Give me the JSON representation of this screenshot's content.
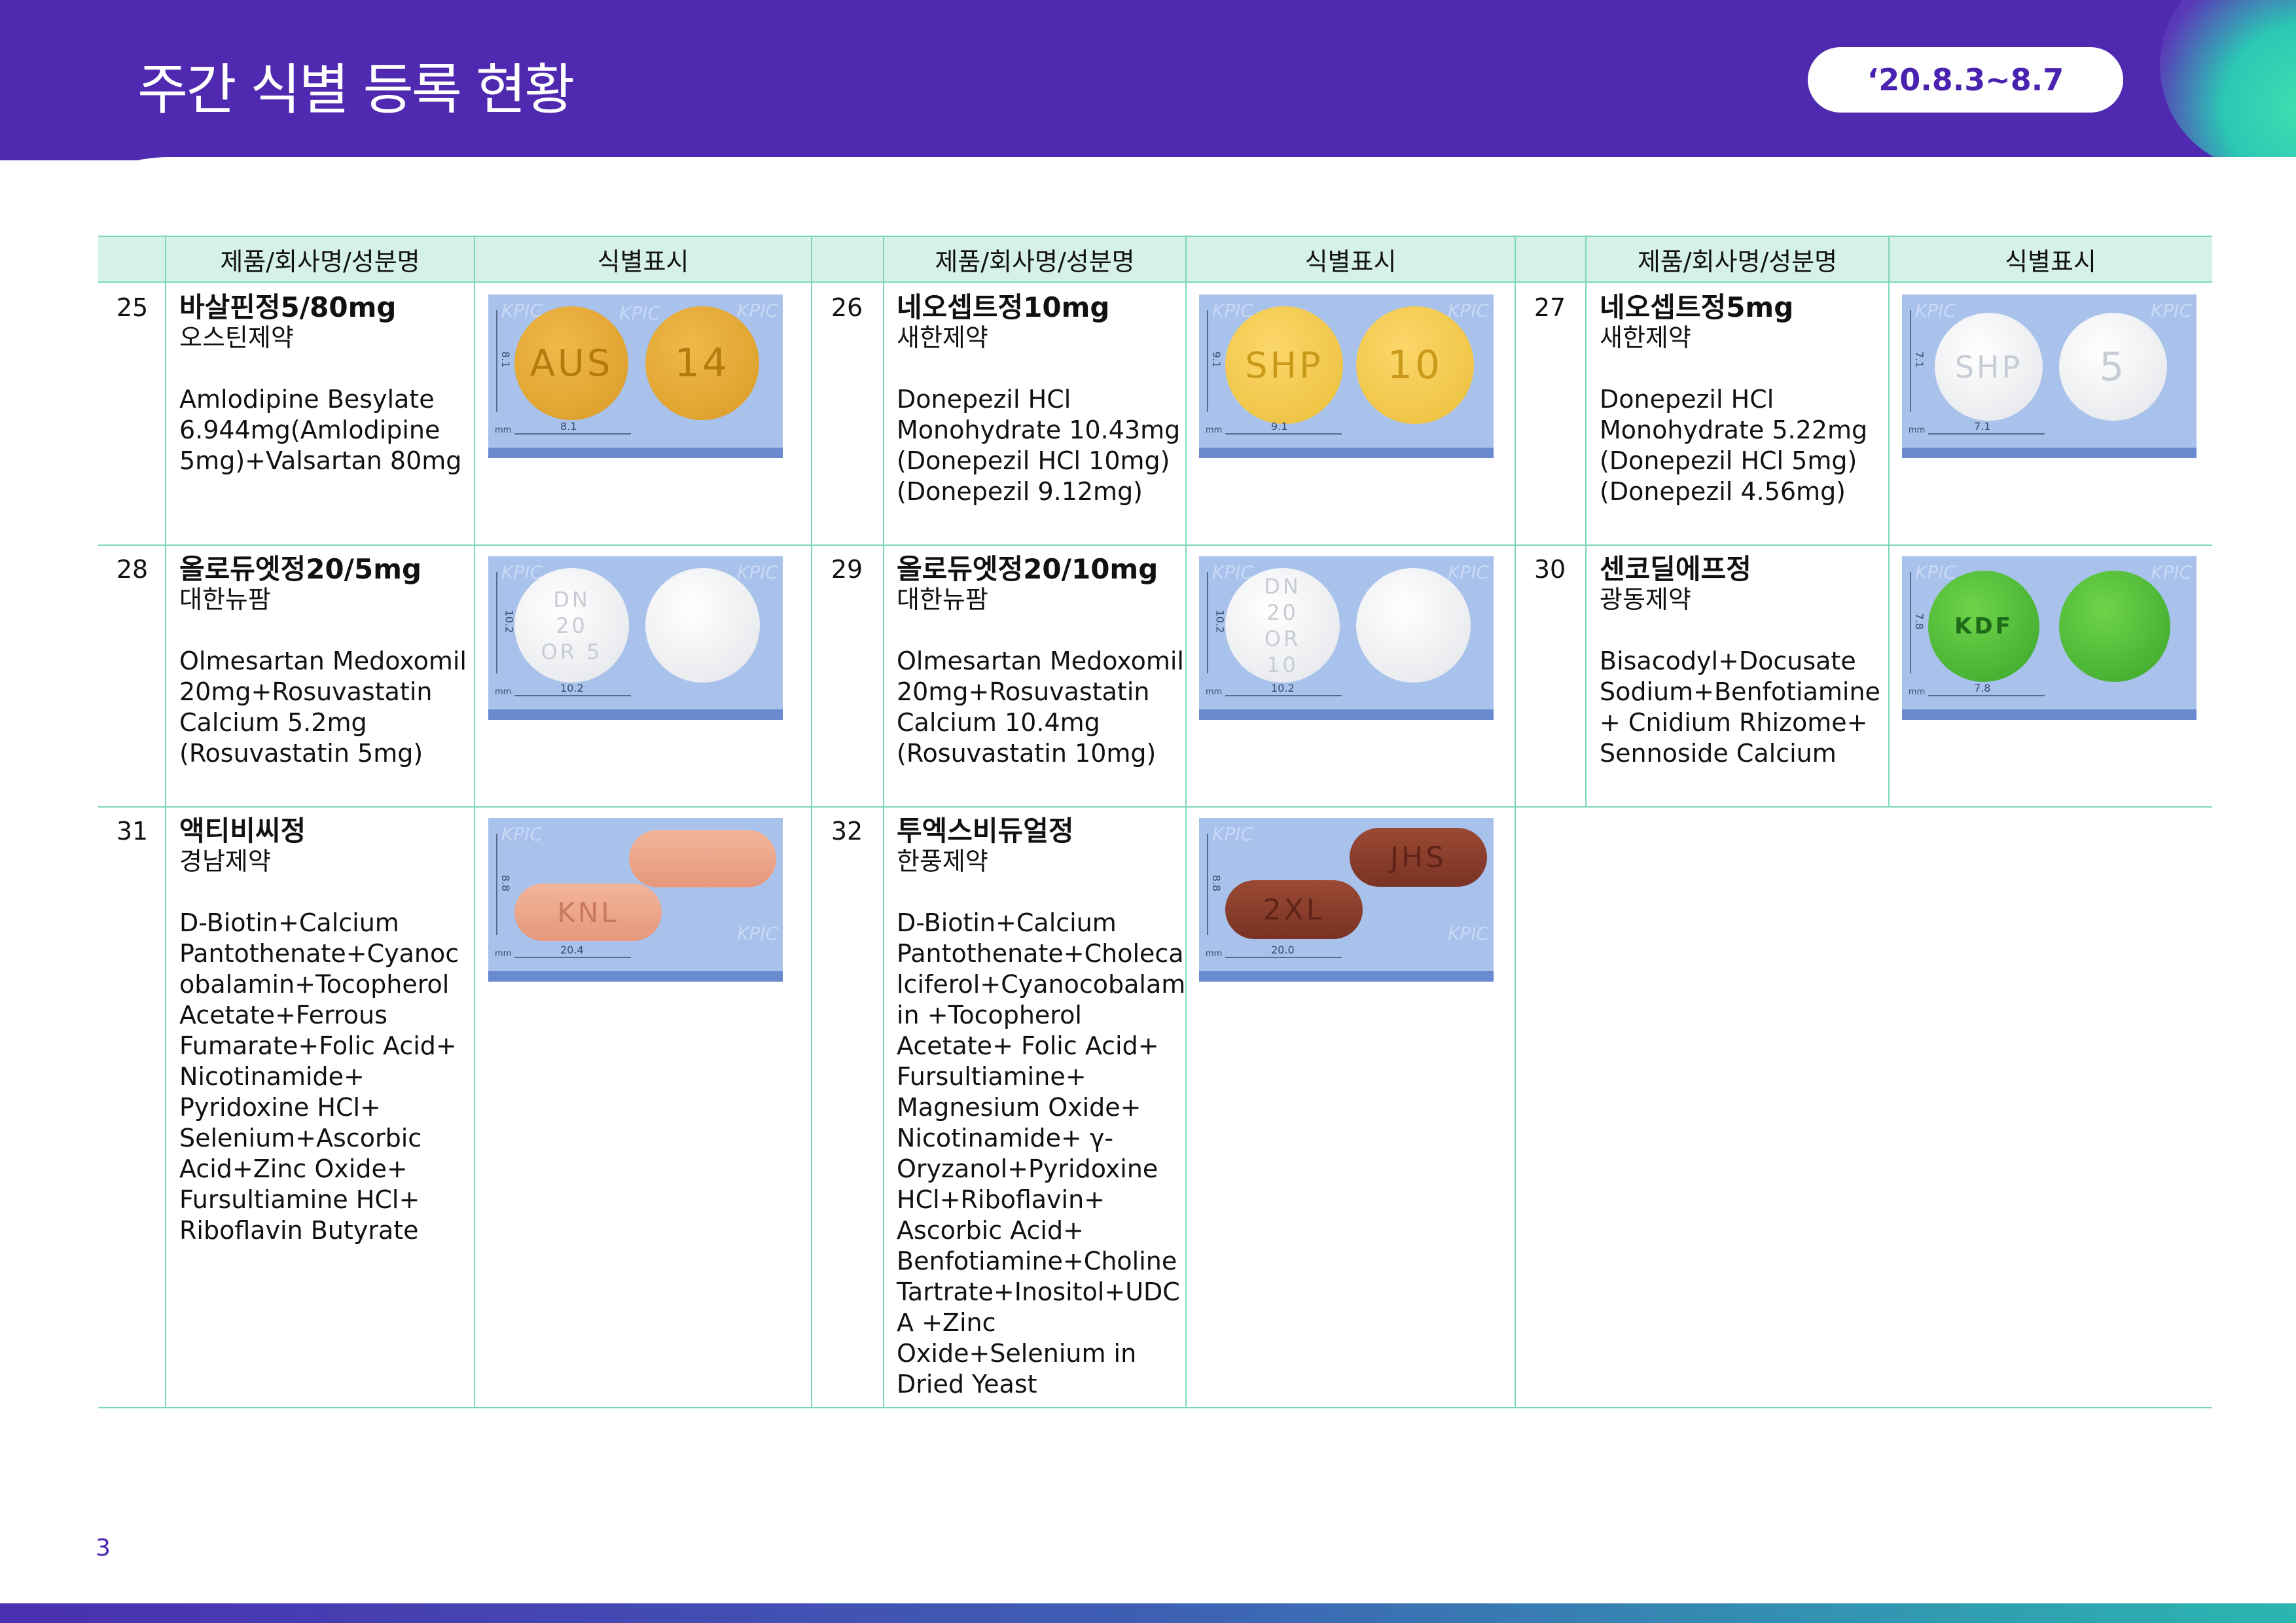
{
  "header": {
    "title": "주간 식별 등록 현황",
    "date_range": "‘20.8.3~8.7"
  },
  "table": {
    "col_product": "제품/회사명/성분명",
    "col_marking": "식별표시"
  },
  "items": [
    {
      "no": "25",
      "name": "바살핀정5/80mg",
      "maker": "오스틴제약",
      "ingredient": "Amlodipine Besylate 6.944mg(Amlodipine 5mg)+Valsartan 80mg",
      "size_v": "8.1",
      "size_h": "8.1",
      "front": "AUS",
      "back": "14"
    },
    {
      "no": "26",
      "name": "네오셉트정10mg",
      "maker": "새한제약",
      "ingredient": "Donepezil HCl Monohydrate 10.43mg (Donepezil HCl 10mg) (Donepezil 9.12mg)",
      "size_v": "9.1",
      "size_h": "9.1",
      "front": "SHP",
      "back": "10"
    },
    {
      "no": "27",
      "name": "네오셉트정5mg",
      "maker": "새한제약",
      "ingredient": "Donepezil HCl Monohydrate 5.22mg (Donepezil HCl 5mg) (Donepezil 4.56mg)",
      "size_v": "7.1",
      "size_h": "7.1",
      "front": "SHP",
      "back": "5"
    },
    {
      "no": "28",
      "name": "올로듀엣정20/5mg",
      "maker": "대한뉴팜",
      "ingredient": "Olmesartan Medoxomil 20mg+Rosuvastatin Calcium 5.2mg (Rosuvastatin 5mg)",
      "size_v": "10.2",
      "size_h": "10.2",
      "front": "DN 20 OR 5",
      "back": ""
    },
    {
      "no": "29",
      "name": "올로듀엣정20/10mg",
      "maker": "대한뉴팜",
      "ingredient": "Olmesartan Medoxomil 20mg+Rosuvastatin Calcium 10.4mg (Rosuvastatin 10mg)",
      "size_v": "10.2",
      "size_h": "10.2",
      "front": "DN 20 OR 10",
      "back": ""
    },
    {
      "no": "30",
      "name": "센코딜에프정",
      "maker": "광동제약",
      "ingredient": "Bisacodyl+Docusate Sodium+Benfotiamine+ Cnidium Rhizome+ Sennoside Calcium",
      "size_v": "7.8",
      "size_h": "7.8",
      "front": "KDF",
      "back": ""
    },
    {
      "no": "31",
      "name": "액티비씨정",
      "maker": "경남제약",
      "ingredient": "D-Biotin+Calcium Pantothenate+Cyanocobalamin+Tocopherol Acetate+Ferrous Fumarate+Folic Acid+ Nicotinamide+ Pyridoxine HCl+ Selenium+Ascorbic Acid+Zinc Oxide+ Fursultiamine HCl+ Riboflavin Butyrate",
      "size_v": "8.8",
      "size_h": "20.4",
      "front": "KNL",
      "back": ""
    },
    {
      "no": "32",
      "name": "투엑스비듀얼정",
      "maker": "한풍제약",
      "ingredient": "D-Biotin+Calcium Pantothenate+Cholecalciferol+Cyanocobalamin +Tocopherol Acetate+ Folic Acid+ Fursultiamine+ Magnesium Oxide+ Nicotinamide+ γ-Oryzanol+Pyridoxine HCl+Riboflavin+ Ascorbic Acid+ Benfotiamine+Choline Tartrate+Inositol+UDCA +Zinc Oxide+Selenium in Dried Yeast",
      "size_v": "8.8",
      "size_h": "20.0",
      "front": "2XL",
      "back": "JHS"
    }
  ],
  "watermark": "KPIC",
  "image_unit": "mm",
  "page_number": "3",
  "colors": {
    "brand": "#4f2ab1",
    "table_line": "#7dd6bc",
    "header_fill": "#d5f1e8",
    "photo_bg": "#a8c2ec"
  }
}
